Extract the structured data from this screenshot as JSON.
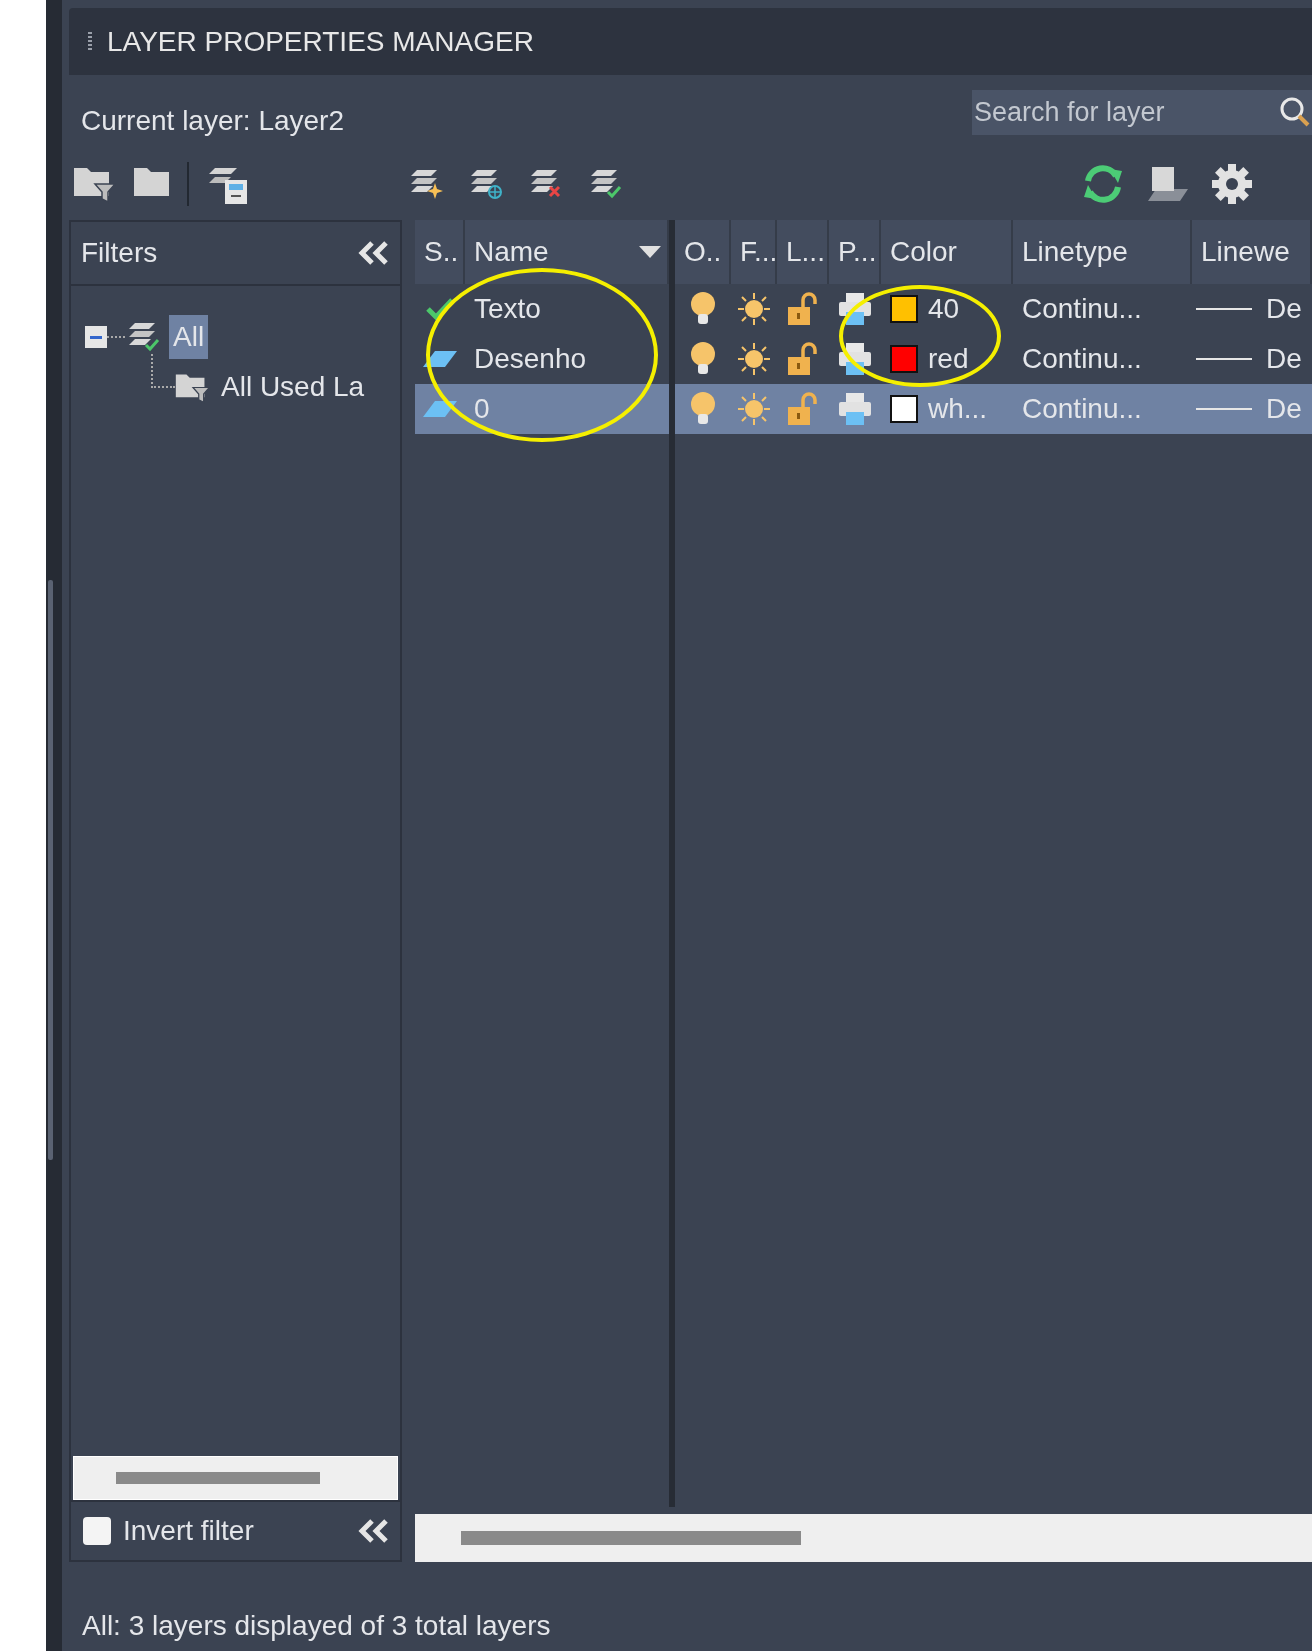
{
  "panel": {
    "title": "LAYER PROPERTIES MANAGER",
    "current_layer": "Current layer: Layer2",
    "search": {
      "placeholder": "Search for layer"
    }
  },
  "filters": {
    "title": "Filters",
    "tree": [
      {
        "label": "All",
        "selected": true,
        "expanded": true,
        "children": [
          {
            "label": "All Used La",
            "selected": false
          }
        ]
      }
    ],
    "invert_filter": {
      "label": "Invert filter",
      "checked": false
    }
  },
  "layers": {
    "columns": [
      "S..",
      "Name",
      "O..",
      "F...",
      "L...",
      "P...",
      "Color",
      "Linetype",
      "Linewe"
    ],
    "rows": [
      {
        "kind": "current",
        "name": "Texto",
        "color": "#ffc000",
        "color_name": "40",
        "linetype": "Continu...",
        "lineweight": "De",
        "selected": false
      },
      {
        "kind": "layer",
        "name": "Desenho",
        "color": "#ff0000",
        "color_name": "red",
        "linetype": "Continu...",
        "lineweight": "De",
        "selected": false
      },
      {
        "kind": "layer",
        "name": "0",
        "color": "#ffffff",
        "color_name": "wh...",
        "linetype": "Continu...",
        "lineweight": "De",
        "selected": true
      }
    ]
  },
  "annotations": [
    {
      "kind": "ellipse"
    },
    {
      "kind": "ellipse"
    }
  ],
  "status_bar": "All: 3 layers displayed of 3 total layers"
}
